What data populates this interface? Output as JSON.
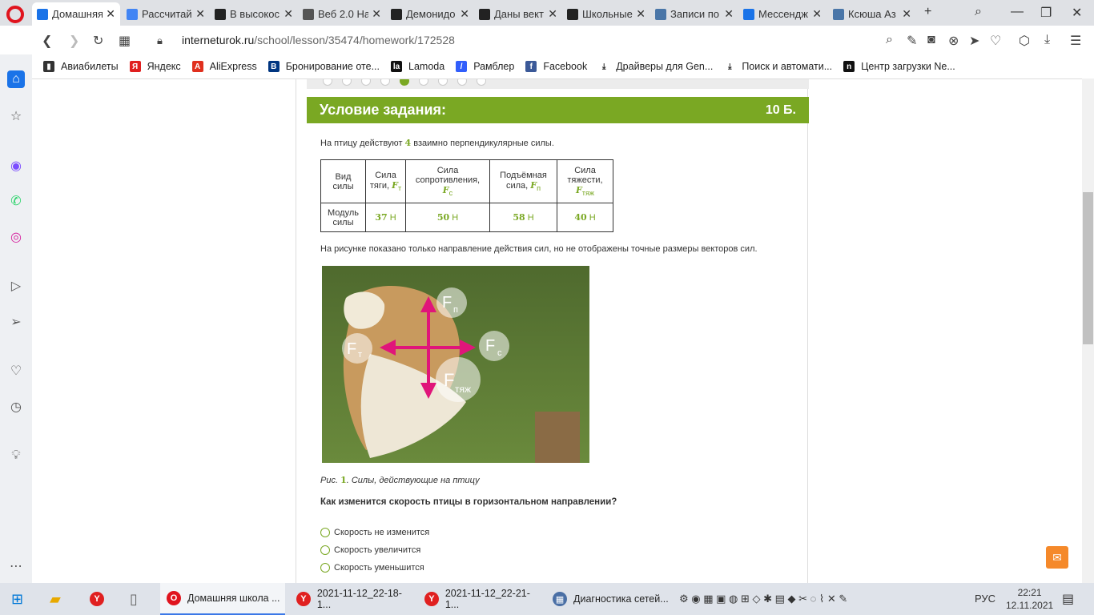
{
  "tabs": [
    {
      "label": "Домашняя",
      "fav": "opera-icon",
      "color": "#1a73e8",
      "active": true
    },
    {
      "label": "Рассчитай",
      "fav": "google-icon",
      "color": "#4285f4"
    },
    {
      "label": "В высокос",
      "fav": "znanija-icon",
      "color": "#222"
    },
    {
      "label": "Веб 2.0 На",
      "fav": "web-icon",
      "color": "#555"
    },
    {
      "label": "Демонидо",
      "fav": "znanija-icon",
      "color": "#222"
    },
    {
      "label": "Даны вект",
      "fav": "znanija-icon",
      "color": "#222"
    },
    {
      "label": "Школьные",
      "fav": "znanija-icon",
      "color": "#222"
    },
    {
      "label": "Записи по",
      "fav": "vk-icon",
      "color": "#4a76a8"
    },
    {
      "label": "Мессендж",
      "fav": "messenger-icon",
      "color": "#1a73e8"
    },
    {
      "label": "Ксюша Аз",
      "fav": "vk-icon",
      "color": "#4a76a8"
    }
  ],
  "address": {
    "host": "interneturok.ru",
    "path": "/school/lesson/35474/homework/172528"
  },
  "bookmarks": [
    {
      "label": "Авиабилеты",
      "color": "#333",
      "glyph": "▮"
    },
    {
      "label": "Яндекс",
      "color": "#e02020",
      "glyph": "Я"
    },
    {
      "label": "AliExpress",
      "color": "#e0301e",
      "glyph": "A"
    },
    {
      "label": "Бронирование оте...",
      "color": "#003580",
      "glyph": "B"
    },
    {
      "label": "Lamoda",
      "color": "#111",
      "glyph": "la"
    },
    {
      "label": "Рамблер",
      "color": "#315efb",
      "glyph": "/"
    },
    {
      "label": "Facebook",
      "color": "#3b5998",
      "glyph": "f"
    },
    {
      "label": "Драйверы для Gen...",
      "color": "#fff",
      "glyph": "⤓"
    },
    {
      "label": "Поиск и автомати...",
      "color": "#fff",
      "glyph": "⤓"
    },
    {
      "label": "Центр загрузки Ne...",
      "color": "#111",
      "glyph": "n"
    }
  ],
  "task": {
    "title": "Условие задания:",
    "score": "10 Б.",
    "intro_before": "На птицу действуют",
    "intro_num": "4",
    "intro_after": "взаимно перпендикулярные силы.",
    "table": {
      "header_kind": "Вид силы",
      "header_modulus": "Модуль силы",
      "cols": [
        {
          "name": "Сила тяги,",
          "sym": "F",
          "sub": "т",
          "value": "37",
          "unit": "Н"
        },
        {
          "name": "Сила сопротивления,",
          "sym": "F",
          "sub": "с",
          "value": "50",
          "unit": "Н"
        },
        {
          "name": "Подъёмная сила,",
          "sym": "F",
          "sub": "п",
          "value": "58",
          "unit": "Н"
        },
        {
          "name": "Сила тяжести,",
          "sym": "F",
          "sub": "тяж",
          "value": "40",
          "unit": "Н"
        }
      ]
    },
    "note": "На рисунке показано только направление действия сил, но не отображены точные размеры векторов сил.",
    "figure_labels": {
      "ft": "F",
      "ft_sub": "т",
      "fp": "F",
      "fp_sub": "п",
      "fc": "F",
      "fc_sub": "с",
      "fg": "F",
      "fg_sub": "тяж"
    },
    "caption_prefix": "Рис.",
    "caption_num": "1",
    "caption_text": ". Силы, действующие на птицу",
    "question": "Как изменится скорость птицы в горизонтальном направлении?",
    "options": [
      "Скорость не изменится",
      "Скорость увеличится",
      "Скорость уменьшится"
    ]
  },
  "taskbar": [
    {
      "label": "Домашняя школа ...",
      "color": "#e0141e",
      "glyph": "O",
      "active": true
    },
    {
      "label": "2021-11-12_22-18-1...",
      "color": "#e02020",
      "glyph": "Y"
    },
    {
      "label": "2021-11-12_22-21-1...",
      "color": "#e02020",
      "glyph": "Y"
    },
    {
      "label": "Диагностика сетей...",
      "color": "#4a6fa5",
      "glyph": "▦"
    }
  ],
  "tray": {
    "lang": "РУС",
    "time": "22:21",
    "date": "12.11.2021"
  },
  "colors": {
    "accent": "#7aa823",
    "force_arrow": "#e0157a"
  }
}
